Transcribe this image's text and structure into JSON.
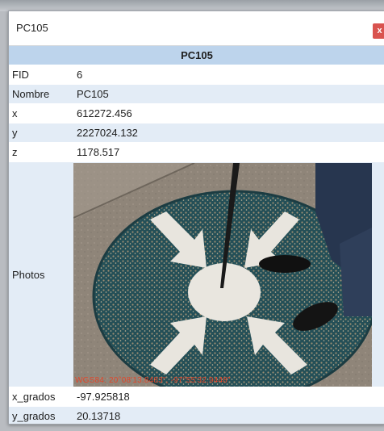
{
  "window": {
    "title": "PC105",
    "close_label": "x"
  },
  "table": {
    "header": "PC105",
    "rows": [
      {
        "key": "FID",
        "value": "6"
      },
      {
        "key": "Nombre",
        "value": "PC105"
      },
      {
        "key": "x",
        "value": "612272.456"
      },
      {
        "key": "y",
        "value": "2227024.132"
      },
      {
        "key": "z",
        "value": "1178.517"
      },
      {
        "key": "Photos",
        "value": ""
      },
      {
        "key": "x_grados",
        "value": "-97.925818"
      },
      {
        "key": "y_grados",
        "value": "20.13718"
      }
    ]
  },
  "photo": {
    "stamp_text": "WGS84: 20°08'13.8483\", -97°55'32.9448\"",
    "stamp_color": "#e2462a"
  },
  "colors": {
    "header_bg": "#bdd4ec",
    "row_alt_bg": "#e3ecf6",
    "close_bg": "#d9534f"
  }
}
